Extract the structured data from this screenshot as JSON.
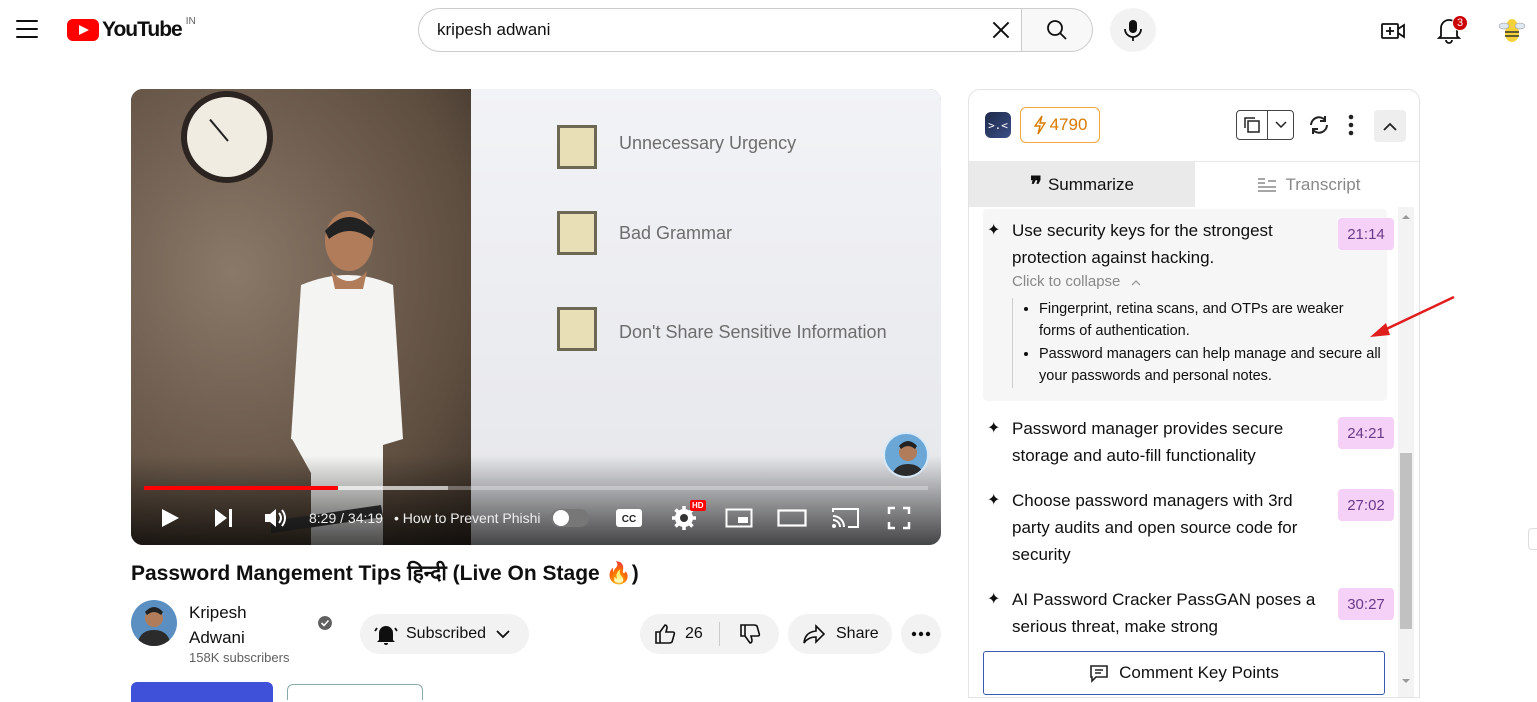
{
  "header": {
    "logo_word": "YouTube",
    "country_code": "IN",
    "search_value": "kripesh adwani",
    "notifications_count": "3"
  },
  "video": {
    "slide_items": [
      "Unnecessary Urgency",
      "Bad Grammar",
      "Don't Share Sensitive Information"
    ],
    "time": "8:29 / 34:19",
    "chapter": "• How to Prevent Phishi",
    "progress_played": 0.247,
    "hd_badge": "HD"
  },
  "meta": {
    "title": "Password Mangement Tips हिन्दी (Live On Stage 🔥)",
    "channel_name": "Kripesh Adwani",
    "subscribers": "158K subscribers",
    "subscribed_label": "Subscribed",
    "likes": "26",
    "share_label": "Share"
  },
  "panel": {
    "credits": "4790",
    "tab_summarize": "Summarize",
    "tab_transcript": "Transcript",
    "collapse_link": "Click to collapse",
    "items": [
      {
        "text": "Use security keys for the strongest protection against hacking.",
        "time": "21:14"
      },
      {
        "text": "Password manager provides secure storage and auto-fill functionality",
        "time": "24:21"
      },
      {
        "text": "Choose password managers with 3rd party audits and open source code for security",
        "time": "27:02"
      },
      {
        "text": "AI Password Cracker PassGAN poses a serious threat, make strong",
        "time": "30:27"
      }
    ],
    "sub_bullets": [
      "Fingerprint, retina scans, and OTPs are weaker forms of authentication.",
      "Password managers can help manage and secure all your passwords and personal notes."
    ],
    "comment_button": "Comment Key Points"
  },
  "colors": {
    "youtube_red": "#ff0000",
    "timestamp_bg": "#f5d0f7",
    "credit_border": "#f1a73a",
    "annotation_arrow": "#e01e1e"
  }
}
